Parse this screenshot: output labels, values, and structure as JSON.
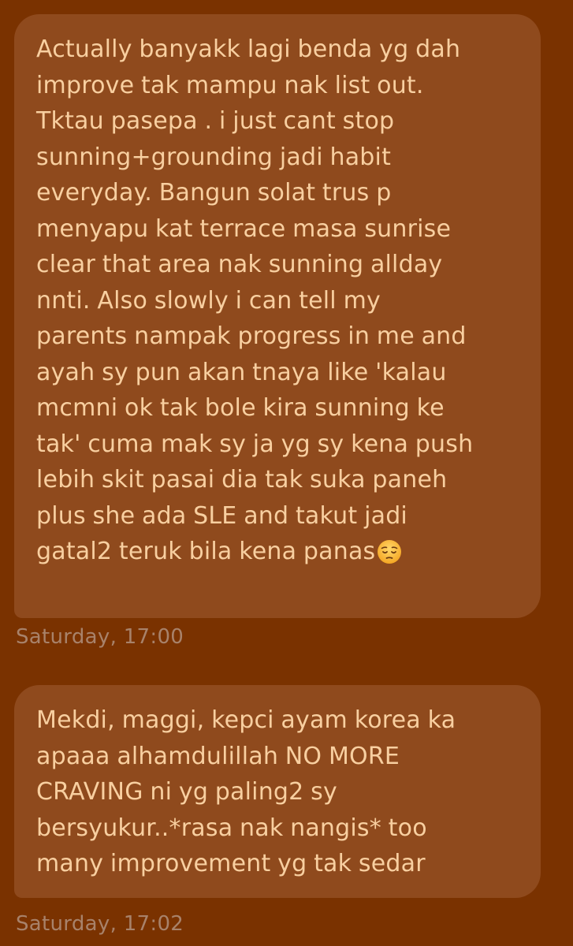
{
  "colors": {
    "background": "#7a3200",
    "bubble": "#8f4a1d",
    "message_text": "#f8cfa0",
    "timestamp_text": "#a8826a"
  },
  "messages": [
    {
      "text": "Actually banyakk lagi benda yg dah\nimprove tak mampu nak list out.\nTktau pasepa . i just cant stop\nsunning+grounding jadi habit\neveryday. Bangun solat trus p\nmenyapu kat terrace masa sunrise\nclear that area nak sunning allday\nnnti. Also slowly i can tell my\nparents nampak progress in me and\nayah sy pun akan tnaya like 'kalau\nmcmni ok tak bole kira sunning ke\ntak' cuma mak sy ja yg sy kena push\nlebih skit pasai dia tak suka paneh\nplus she ada SLE and takut jadi\ngatal2 teruk bila kena panas",
      "trailing_emoji": "pensive-face-emoji",
      "timestamp": "Saturday, 17:00"
    },
    {
      "text": "Mekdi, maggi, kepci ayam korea ka\napaaa alhamdulillah NO MORE\nCRAVING ni yg paling2 sy\nbersyukur..*rasa nak nangis* too\nmany improvement yg tak sedar",
      "timestamp": "Saturday, 17:02"
    }
  ]
}
